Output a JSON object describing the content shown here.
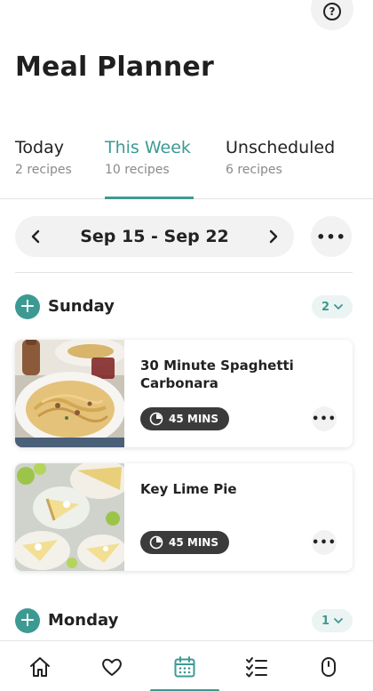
{
  "header": {
    "title": "Meal Planner",
    "help_icon": "help-circle-icon"
  },
  "tabs": [
    {
      "label": "Today",
      "count": "2 recipes",
      "active": false
    },
    {
      "label": "This Week",
      "count": "10 recipes",
      "active": true
    },
    {
      "label": "Unscheduled",
      "count": "6 recipes",
      "active": false
    }
  ],
  "week": {
    "range": "Sep 15 - Sep 22",
    "prev_icon": "chevron-left-icon",
    "next_icon": "chevron-right-icon",
    "more_icon": "more-horizontal-icon"
  },
  "days": [
    {
      "name": "Sunday",
      "count": "2",
      "recipes": [
        {
          "title": "30 Minute Spaghetti Carbonara",
          "time": "45 MINS"
        },
        {
          "title": "Key Lime Pie",
          "time": "45 MINS"
        }
      ]
    },
    {
      "name": "Monday",
      "count": "1"
    }
  ],
  "nav": {
    "items": [
      "home-icon",
      "heart-icon",
      "calendar-icon",
      "checklist-icon",
      "settings-icon"
    ],
    "active": "calendar-icon"
  },
  "colors": {
    "accent": "#3d9a93",
    "pill_dark": "#3b3b3b",
    "surface": "#f2f2f2"
  }
}
